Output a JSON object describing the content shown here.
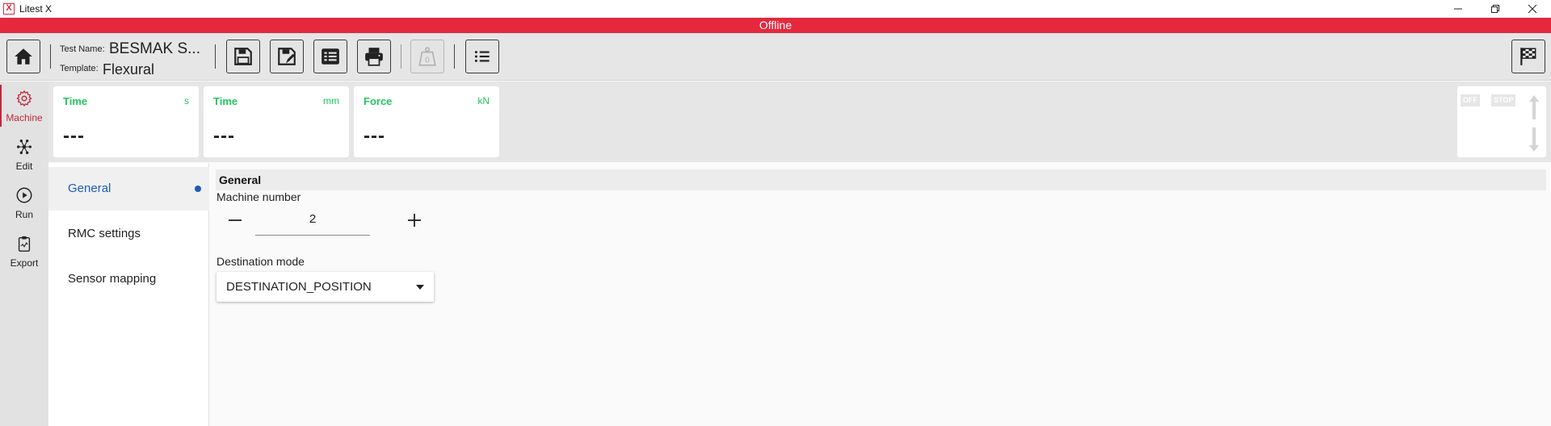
{
  "window": {
    "title": "Litest X",
    "logo_text": "X",
    "minimize_icon": "minimize-icon",
    "restore_icon": "restore-icon",
    "close_icon": "close-icon"
  },
  "status": {
    "text": "Offline",
    "color": "#e5283e"
  },
  "toolbar": {
    "test_name_label": "Test Name:",
    "test_name_value": "BESMAK S...",
    "template_label": "Template:",
    "template_value": "Flexural",
    "buttons": [
      "home-icon",
      "save-icon",
      "save-as-icon",
      "list-detail-icon",
      "print-icon",
      "tare-weight-icon",
      "list-icon",
      "finish-flag-icon"
    ]
  },
  "nav": {
    "items": [
      {
        "label": "Machine",
        "icon": "gear-icon",
        "active": true
      },
      {
        "label": "Edit",
        "icon": "network-icon",
        "active": false
      },
      {
        "label": "Run",
        "icon": "play-circle-icon",
        "active": false
      },
      {
        "label": "Export",
        "icon": "clipboard-icon",
        "active": false
      }
    ]
  },
  "readouts": [
    {
      "name": "Time",
      "unit": "s",
      "value": "---"
    },
    {
      "name": "Time",
      "unit": "mm",
      "value": "---"
    },
    {
      "name": "Force",
      "unit": "kN",
      "value": "---"
    }
  ],
  "controls": {
    "off_label": "OFF",
    "stop_label": "STOP"
  },
  "side_tabs": [
    {
      "label": "General",
      "active": true
    },
    {
      "label": "RMC settings",
      "active": false
    },
    {
      "label": "Sensor mapping",
      "active": false
    }
  ],
  "general": {
    "header": "General",
    "machine_number_label": "Machine number",
    "machine_number_value": "2",
    "destination_mode_label": "Destination mode",
    "destination_mode_value": "DESTINATION_POSITION"
  },
  "colors": {
    "accent_red": "#c3273a",
    "accent_blue": "#1e5bb8",
    "readout_green": "#22c55e"
  }
}
